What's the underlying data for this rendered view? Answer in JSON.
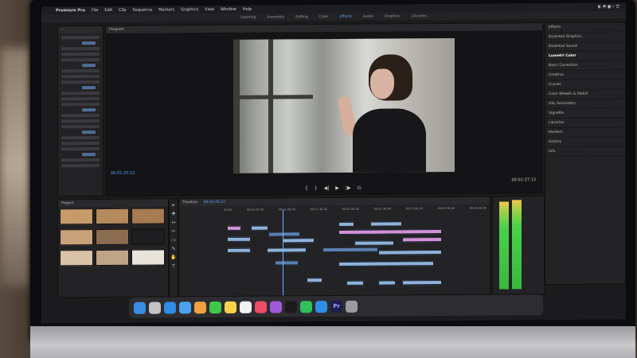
{
  "menubar": {
    "app": "Premiere Pro",
    "items": [
      "File",
      "Edit",
      "Clip",
      "Sequence",
      "Markers",
      "Graphics",
      "View",
      "Window",
      "Help"
    ]
  },
  "workspace_tabs": [
    "Learning",
    "Assembly",
    "Editing",
    "Color",
    "Effects",
    "Audio",
    "Graphics",
    "Libraries"
  ],
  "workspace_active": "Effects",
  "program_panel": {
    "title": "Program",
    "timecode_left": "00:01:25:22",
    "timecode_right": "00:01:27:13"
  },
  "right_panel": {
    "labels": [
      "Effects",
      "Essential Graphics",
      "Essential Sound",
      "Lumetri Color",
      "Basic Correction",
      "Creative",
      "Curves",
      "Color Wheels & Match",
      "HSL Secondary",
      "Vignette",
      "Libraries",
      "Markers",
      "History",
      "Info"
    ],
    "selected": "Lumetri Color"
  },
  "project_panel": {
    "title": "Project"
  },
  "timeline": {
    "title": "Timeline",
    "timecode": "00:01:25:22",
    "ruler": [
      "00:00",
      "00:00:30:00",
      "00:01:00:00",
      "00:01:30:00",
      "00:02:00:00",
      "00:02:30:00",
      "00:03:00:00",
      "00:03:30:00",
      "00:04:00:00"
    ]
  },
  "dock": {
    "icons": [
      "finder-icon",
      "launchpad-icon",
      "safari-icon",
      "mail-icon",
      "photos-icon",
      "messages-icon",
      "notes-icon",
      "calendar-icon",
      "music-icon",
      "podcasts-icon",
      "tv-icon",
      "numbers-icon",
      "appstore-icon",
      "premiere-icon",
      "trash-icon"
    ],
    "premiere_label": "Pr"
  },
  "colors": {
    "accent": "#5aa0ff",
    "pink_clip": "#d392d8",
    "blue_clip": "#8fb2d8",
    "meter": "#4ad04a"
  }
}
